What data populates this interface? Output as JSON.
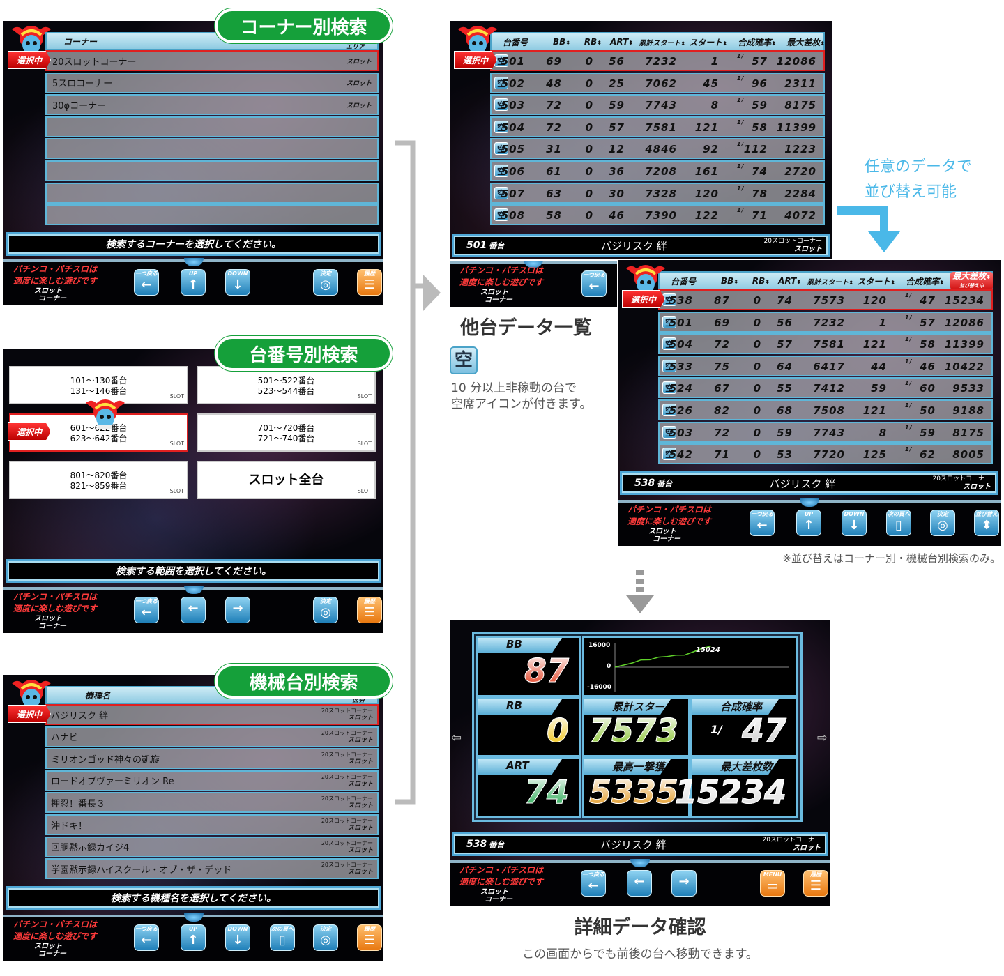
{
  "common": {
    "selected_tag": "選択中",
    "warning_line1": "パチンコ・パチスロは",
    "warning_line2": "適度に楽しむ遊びです",
    "corner_line1": "スロット",
    "corner_line2": "コーナー",
    "empty_icon": "空"
  },
  "corner_search": {
    "pill": "コーナー別検索",
    "header": "コーナー",
    "header_right": "エリア",
    "rows": [
      {
        "name": "20スロットコーナー",
        "type": "スロット"
      },
      {
        "name": "5スロコーナー",
        "type": "スロット"
      },
      {
        "name": "30φコーナー",
        "type": "スロット"
      },
      {
        "name": "",
        "type": ""
      },
      {
        "name": "",
        "type": ""
      },
      {
        "name": "",
        "type": ""
      },
      {
        "name": "",
        "type": ""
      },
      {
        "name": "",
        "type": ""
      }
    ],
    "status": "検索するコーナーを選択してください。",
    "buttons": [
      {
        "label": "一つ戻る",
        "icon": "←",
        "color": "blue"
      },
      {
        "label": "UP",
        "icon": "↑",
        "color": "blue"
      },
      {
        "label": "DOWN",
        "icon": "↓",
        "color": "blue"
      },
      {
        "label": "決定",
        "icon": "◎",
        "color": "blue"
      },
      {
        "label": "履歴",
        "icon": "☰",
        "color": "orange"
      }
    ]
  },
  "number_search": {
    "pill": "台番号別検索",
    "cards": [
      {
        "l1": "101～130番台",
        "l2": "131～146番台",
        "tag": "SLOT"
      },
      {
        "l1": "501～522番台",
        "l2": "523～544番台",
        "tag": "SLOT"
      },
      {
        "l1": "601～622番台",
        "l2": "623～642番台",
        "tag": "SLOT",
        "selected": true
      },
      {
        "l1": "701～720番台",
        "l2": "721～740番台",
        "tag": "SLOT"
      },
      {
        "l1": "801～820番台",
        "l2": "821～859番台",
        "tag": "SLOT"
      },
      {
        "l1": "スロット全台",
        "l2": "",
        "tag": "SLOT",
        "big": true
      }
    ],
    "status": "検索する範囲を選択してください。",
    "buttons": [
      {
        "label": "一つ戻る",
        "icon": "←",
        "color": "blue"
      },
      {
        "label": "",
        "icon": "←",
        "color": "blue"
      },
      {
        "label": "",
        "icon": "→",
        "color": "blue"
      },
      {
        "label": "決定",
        "icon": "◎",
        "color": "blue"
      },
      {
        "label": "履歴",
        "icon": "☰",
        "color": "orange"
      }
    ]
  },
  "machine_search": {
    "pill": "機械台別検索",
    "header": "機種名",
    "header_right": "区分",
    "rows": [
      {
        "name": "バジリスク 絆",
        "corner": "20スロットコーナー",
        "type": "スロット"
      },
      {
        "name": "ハナビ",
        "corner": "20スロットコーナー",
        "type": "スロット"
      },
      {
        "name": "ミリオンゴッド神々の凱旋",
        "corner": "20スロットコーナー",
        "type": "スロット"
      },
      {
        "name": "ロードオブヴァーミリオン Re",
        "corner": "20スロットコーナー",
        "type": "スロット"
      },
      {
        "name": "押忍！番長３",
        "corner": "20スロットコーナー",
        "type": "スロット"
      },
      {
        "name": "沖ドキ！",
        "corner": "20スロットコーナー",
        "type": "スロット"
      },
      {
        "name": "回胴黙示録カイジ4",
        "corner": "20スロットコーナー",
        "type": "スロット"
      },
      {
        "name": "学園黙示録ハイスクール・オブ・ザ・デッド",
        "corner": "20スロットコーナー",
        "type": "スロット"
      }
    ],
    "status": "検索する機種名を選択してください。",
    "buttons": [
      {
        "label": "一つ戻る",
        "icon": "←",
        "color": "blue"
      },
      {
        "label": "UP",
        "icon": "↑",
        "color": "blue"
      },
      {
        "label": "DOWN",
        "icon": "↓",
        "color": "blue"
      },
      {
        "label": "次の頁へ",
        "icon": "▯",
        "color": "blue"
      },
      {
        "label": "決定",
        "icon": "◎",
        "color": "blue"
      },
      {
        "label": "履歴",
        "icon": "☰",
        "color": "orange"
      }
    ]
  },
  "other_list": {
    "columns": [
      "台番号",
      "BB",
      "RB",
      "ART",
      "累計スタート",
      "スタート",
      "合成確率",
      "最大差枚"
    ],
    "rows": [
      [
        "501",
        "69",
        "0",
        "56",
        "7232",
        "1",
        "57",
        "12086"
      ],
      [
        "502",
        "48",
        "0",
        "25",
        "7062",
        "45",
        "96",
        "2311"
      ],
      [
        "503",
        "72",
        "0",
        "59",
        "7743",
        "8",
        "59",
        "8175"
      ],
      [
        "504",
        "72",
        "0",
        "57",
        "7581",
        "121",
        "58",
        "11399"
      ],
      [
        "505",
        "31",
        "0",
        "12",
        "4846",
        "92",
        "112",
        "1223"
      ],
      [
        "506",
        "61",
        "0",
        "36",
        "7208",
        "161",
        "74",
        "2720"
      ],
      [
        "507",
        "63",
        "0",
        "30",
        "7328",
        "120",
        "78",
        "2284"
      ],
      [
        "508",
        "58",
        "0",
        "46",
        "7390",
        "122",
        "71",
        "4072"
      ]
    ],
    "prob_prefix": "1/",
    "status": {
      "number": "501",
      "unit": "番台",
      "machine": "バジリスク 絆",
      "corner": "20スロットコーナー",
      "type": "スロット"
    },
    "buttons": [
      {
        "label": "一つ戻る",
        "icon": "←",
        "color": "blue"
      }
    ],
    "title": "他台データ一覧",
    "caption_line1": "10 分以上非稼動の台で",
    "caption_line2": "空席アイコンが付きます。"
  },
  "sort_note": {
    "line1": "任意のデータで",
    "line2": "並び替え可能"
  },
  "sorted_list": {
    "sort_column_sub": "並び替え中",
    "rows": [
      [
        "538",
        "87",
        "0",
        "74",
        "7573",
        "120",
        "47",
        "15234"
      ],
      [
        "501",
        "69",
        "0",
        "56",
        "7232",
        "1",
        "57",
        "12086"
      ],
      [
        "504",
        "72",
        "0",
        "57",
        "7581",
        "121",
        "58",
        "11399"
      ],
      [
        "533",
        "75",
        "0",
        "64",
        "6417",
        "44",
        "46",
        "10422"
      ],
      [
        "524",
        "67",
        "0",
        "55",
        "7412",
        "59",
        "60",
        "9533"
      ],
      [
        "526",
        "82",
        "0",
        "68",
        "7508",
        "121",
        "50",
        "9188"
      ],
      [
        "503",
        "72",
        "0",
        "59",
        "7743",
        "8",
        "59",
        "8175"
      ],
      [
        "542",
        "71",
        "0",
        "53",
        "7720",
        "125",
        "62",
        "8005"
      ]
    ],
    "status": {
      "number": "538",
      "unit": "番台",
      "machine": "バジリスク 絆",
      "corner": "20スロットコーナー",
      "type": "スロット"
    },
    "buttons": [
      {
        "label": "一つ戻る",
        "icon": "←",
        "color": "blue"
      },
      {
        "label": "UP",
        "icon": "↑",
        "color": "blue"
      },
      {
        "label": "DOWN",
        "icon": "↓",
        "color": "blue"
      },
      {
        "label": "次の頁へ",
        "icon": "▯",
        "color": "blue"
      },
      {
        "label": "決定",
        "icon": "◎",
        "color": "blue"
      },
      {
        "label": "並び替え",
        "icon": "⬍",
        "color": "blue"
      }
    ],
    "note": "※並び替えはコーナー別・機械台別検索のみ。"
  },
  "detail": {
    "bb_label": "BB",
    "bb": "87",
    "rb_label": "RB",
    "rb": "0",
    "art_label": "ART",
    "art": "74",
    "total_start_label": "累計スタート",
    "total_start": "7573",
    "prob_label": "合成確率",
    "prob_prefix": "1/",
    "prob": "47",
    "max_hit_label": "最高一撃獲得枚数",
    "max_hit": "5335",
    "max_diff_label": "最大差枚数",
    "max_diff": "15234",
    "graph": {
      "y_max": "16000",
      "y_zero": "0",
      "y_min": "-16000",
      "end_label": "15024",
      "values": [
        0,
        1500,
        3000,
        5200,
        5300,
        7200,
        7600,
        8600,
        8700,
        11000,
        13500,
        15024
      ],
      "ylim": [
        -16000,
        16000
      ]
    },
    "status": {
      "number": "538",
      "unit": "番台",
      "machine": "バジリスク 絆",
      "corner": "20スロットコーナー",
      "type": "スロット"
    },
    "buttons": [
      {
        "label": "一つ戻る",
        "icon": "←",
        "color": "blue"
      },
      {
        "label": "",
        "icon": "←",
        "color": "blue"
      },
      {
        "label": "",
        "icon": "→",
        "color": "blue"
      },
      {
        "label": "MENU",
        "icon": "▭",
        "color": "orange"
      },
      {
        "label": "履歴",
        "icon": "☰",
        "color": "orange"
      }
    ],
    "title": "詳細データ確認",
    "caption": "この画面からでも前後の台へ移動できます。"
  },
  "colors": {
    "pill_green": "#15a03a",
    "accent_blue": "#4ab8e8",
    "select_red": "#e02020"
  }
}
